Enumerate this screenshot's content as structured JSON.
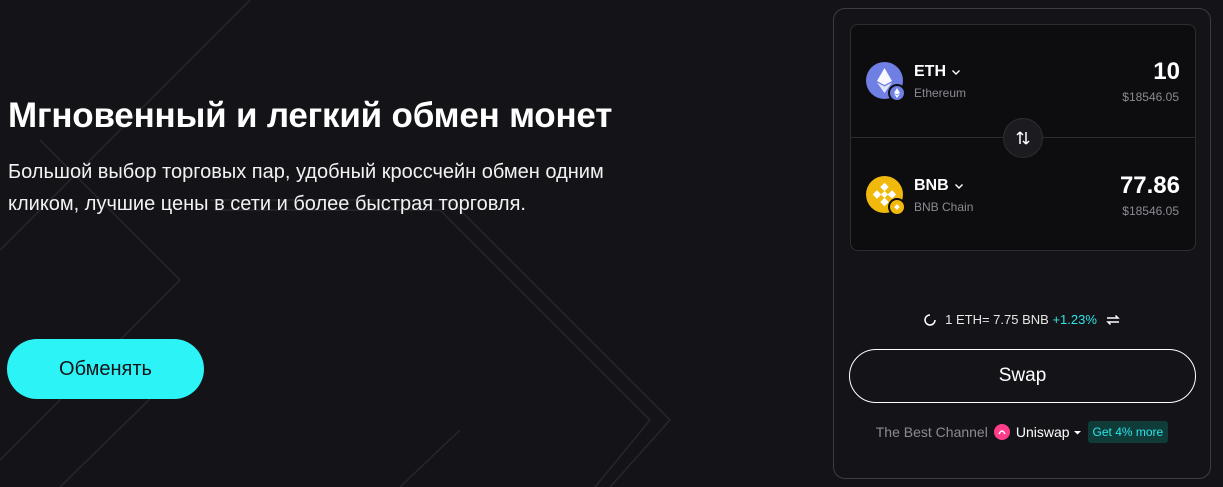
{
  "hero": {
    "title": "Мгновенный и легкий обмен монет",
    "subtitle": "Большой выбор торговых пар, удобный кроссчейн обмен одним кликом, лучшие цены в сети и более быстрая торговля.",
    "cta_label": "Обменять"
  },
  "swap": {
    "from": {
      "symbol": "ETH",
      "chain": "Ethereum",
      "amount": "10",
      "usd_value": "$18546.05",
      "icon": "ethereum-icon"
    },
    "to": {
      "symbol": "BNB",
      "chain": "BNB Chain",
      "amount": "77.86",
      "usd_value": "$18546.05",
      "icon": "bnb-icon"
    },
    "rate_text": "1 ETH= 7.75 BNB",
    "rate_change": "+1.23%",
    "button_label": "Swap",
    "channel_label": "The Best Channel",
    "channel_name": "Uniswap",
    "promo_label": "Get 4% more"
  },
  "colors": {
    "background": "#141418",
    "accent_cyan": "#2cf3f6",
    "eth": "#6f7fe3",
    "bnb": "#f0b90b",
    "uniswap": "#ff3d8b",
    "positive": "#2de4e8"
  }
}
